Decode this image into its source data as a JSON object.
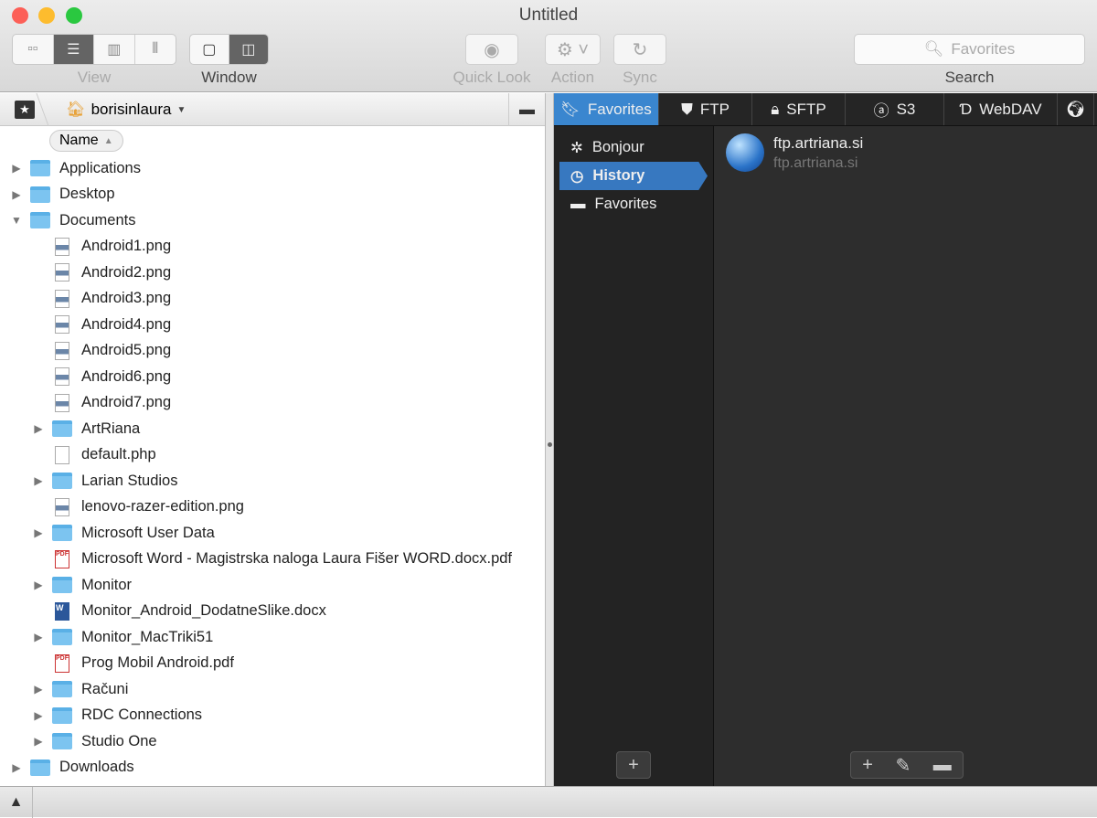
{
  "window": {
    "title": "Untitled"
  },
  "toolbar": {
    "view_label": "View",
    "window_label": "Window",
    "quicklook_label": "Quick Look",
    "action_label": "Action",
    "sync_label": "Sync",
    "search_placeholder": "Favorites",
    "search_label": "Search"
  },
  "path": {
    "location": "borisinlaura"
  },
  "columns": {
    "name": "Name"
  },
  "files": [
    {
      "name": "Applications",
      "level": 0,
      "type": "folder",
      "expanded": false
    },
    {
      "name": "Desktop",
      "level": 0,
      "type": "folder",
      "expanded": false
    },
    {
      "name": "Documents",
      "level": 0,
      "type": "folder",
      "expanded": true
    },
    {
      "name": "Android1.png",
      "level": 1,
      "type": "image"
    },
    {
      "name": "Android2.png",
      "level": 1,
      "type": "image"
    },
    {
      "name": "Android3.png",
      "level": 1,
      "type": "image"
    },
    {
      "name": "Android4.png",
      "level": 1,
      "type": "image"
    },
    {
      "name": "Android5.png",
      "level": 1,
      "type": "image"
    },
    {
      "name": "Android6.png",
      "level": 1,
      "type": "image"
    },
    {
      "name": "Android7.png",
      "level": 1,
      "type": "image"
    },
    {
      "name": "ArtRiana",
      "level": 1,
      "type": "folder",
      "expanded": false
    },
    {
      "name": "default.php",
      "level": 1,
      "type": "file"
    },
    {
      "name": "Larian Studios",
      "level": 1,
      "type": "folder",
      "expanded": false
    },
    {
      "name": "lenovo-razer-edition.png",
      "level": 1,
      "type": "image"
    },
    {
      "name": "Microsoft User Data",
      "level": 1,
      "type": "folder",
      "expanded": false
    },
    {
      "name": "Microsoft Word - Magistrska naloga Laura Fišer WORD.docx.pdf",
      "level": 1,
      "type": "pdf"
    },
    {
      "name": "Monitor",
      "level": 1,
      "type": "folder",
      "expanded": false
    },
    {
      "name": "Monitor_Android_DodatneSlike.docx",
      "level": 1,
      "type": "doc"
    },
    {
      "name": "Monitor_MacTriki51",
      "level": 1,
      "type": "folder",
      "expanded": false
    },
    {
      "name": "Prog Mobil Android.pdf",
      "level": 1,
      "type": "pdf"
    },
    {
      "name": "Računi",
      "level": 1,
      "type": "folder",
      "expanded": false
    },
    {
      "name": "RDC Connections",
      "level": 1,
      "type": "folder",
      "expanded": false
    },
    {
      "name": "Studio One",
      "level": 1,
      "type": "folder",
      "expanded": false
    },
    {
      "name": "Downloads",
      "level": 0,
      "type": "folder",
      "expanded": false
    }
  ],
  "tabs": [
    {
      "label": "Favorites",
      "icon": "bookmark-icon",
      "active": true
    },
    {
      "label": "FTP",
      "icon": "ftp-icon"
    },
    {
      "label": "SFTP",
      "icon": "lock-icon"
    },
    {
      "label": "S3",
      "icon": "amazon-icon"
    },
    {
      "label": "WebDAV",
      "icon": "webdav-icon"
    }
  ],
  "sources": [
    {
      "label": "Bonjour",
      "icon": "bonjour-icon"
    },
    {
      "label": "History",
      "icon": "clock-icon",
      "active": true
    },
    {
      "label": "Favorites",
      "icon": "folder-icon"
    }
  ],
  "history": [
    {
      "title": "ftp.artriana.si",
      "subtitle": "ftp.artriana.si"
    }
  ],
  "colors": {
    "accent": "#3a86cf",
    "dark_bg": "#2d2d2d"
  }
}
